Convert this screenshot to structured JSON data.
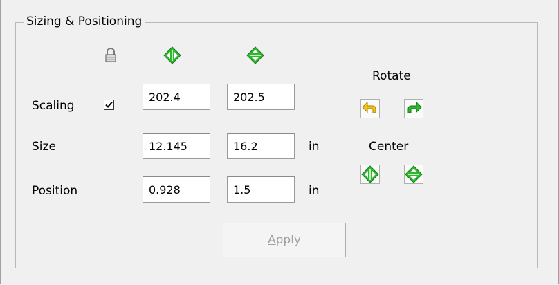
{
  "group": {
    "title": "Sizing & Positioning"
  },
  "header_icons": {
    "lock": "lock-icon",
    "flip_horizontal": "flip-horizontal-icon",
    "flip_vertical": "flip-vertical-icon"
  },
  "rows": {
    "scaling": {
      "label": "Scaling",
      "lock_checked": true,
      "x": "202.4",
      "y": "202.5"
    },
    "size": {
      "label": "Size",
      "x": "12.145",
      "y": "16.2",
      "unit": "in"
    },
    "position": {
      "label": "Position",
      "x": "0.928",
      "y": "1.5",
      "unit": "in"
    }
  },
  "rotate": {
    "label": "Rotate",
    "left_icon": "rotate-left-icon",
    "right_icon": "rotate-right-icon"
  },
  "center": {
    "label": "Center",
    "horizontal_icon": "center-horizontal-icon",
    "vertical_icon": "center-vertical-icon"
  },
  "apply": {
    "label": "Apply",
    "mnemonic": "A",
    "rest": "pply",
    "enabled": false
  },
  "colors": {
    "background": "#f0f0f0",
    "green_icon": "#2eb82e",
    "yellow_icon": "#f2c318",
    "disabled_text": "#a0a0a0"
  }
}
